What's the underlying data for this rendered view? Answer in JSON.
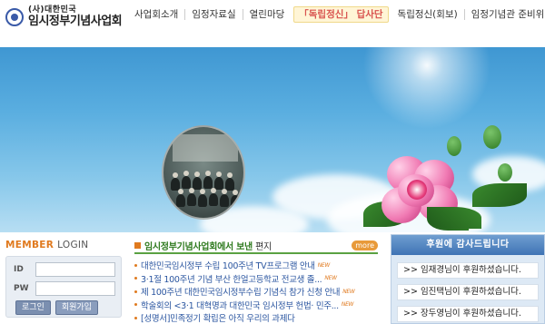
{
  "logo": {
    "small": "(사)대한민국",
    "big": "임시정부기념사업회"
  },
  "nav": {
    "items": [
      "사업회소개",
      "임정자료실",
      "열린마당"
    ],
    "special": {
      "bracket_open": "「",
      "text": "독립정신",
      "bracket_close": "」",
      "suffix": "답사단"
    },
    "items_after": [
      "독립정신(회보)",
      "임정기념관 준비위"
    ]
  },
  "banner": {
    "accent_colors": {
      "sky_top": "#3f97d2",
      "sky_bottom": "#b7def3",
      "flower": "#f07ab3"
    }
  },
  "login": {
    "member": "MEMBER",
    "login_word": "LOGIN",
    "id_label": "ID",
    "pw_label": "PW",
    "login_button": "로그인",
    "join_button": "회원가입"
  },
  "news": {
    "title_highlight": "임시정부기념사업회에서 보낸",
    "title_plain": "편지",
    "more": "more",
    "new_label": "NEW",
    "items": [
      "대한민국임시정부 수립 100주년 TV프로그램 안내",
      "3·1절 100주년 기념 부산 한얼고등학교 전교생 졸...",
      "제 100주년 대한민국임시정부수립 기념식 참가 신청 안내",
      "학술회의 <3·1 대혁명과 대한민국 임시정부 헌법· 민주...",
      "[성명서]민족정기 확립은 아직 우리의 과제다"
    ]
  },
  "thanks": {
    "title": "후원에 감사드립니다",
    "items": [
      ">> 임재경님이 후원하셨습니다.",
      ">> 임진택님이 후원하셨습니다.",
      ">> 장두영님이 후원하셨습니다."
    ]
  }
}
